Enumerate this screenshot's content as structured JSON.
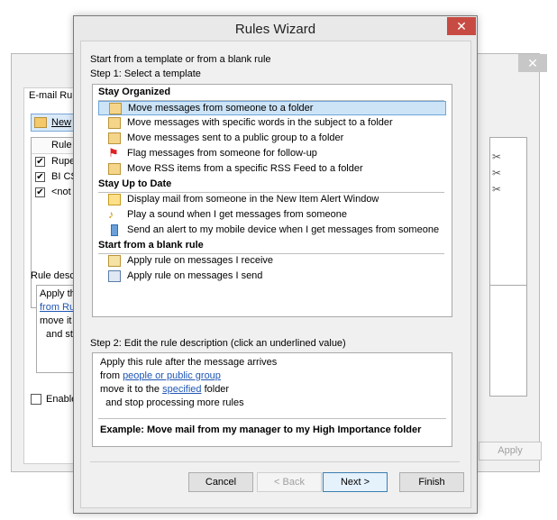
{
  "background_window": {
    "tab_label": "E-mail Rule",
    "new_button_label": "New",
    "list_header": "Rule",
    "rules": [
      {
        "checked": true,
        "name": "Rupe"
      },
      {
        "checked": true,
        "name": "BI CS"
      },
      {
        "checked": true,
        "name": "<not"
      }
    ],
    "description_label": "Rule desc",
    "description_lines": [
      "Apply th",
      "from Rup",
      "move it t",
      "and sto"
    ],
    "enable_label": "Enable",
    "apply_label": "Apply"
  },
  "dialog": {
    "title": "Rules Wizard",
    "close_glyph": "✕",
    "intro": "Start from a template or from a blank rule",
    "step1_label": "Step 1: Select a template",
    "groups": [
      {
        "heading": "Stay Organized",
        "items": [
          {
            "icon": "folder-move-icon",
            "label": "Move messages from someone to a folder",
            "selected": true
          },
          {
            "icon": "folder-move-icon",
            "label": "Move messages with specific words in the subject to a folder",
            "selected": false
          },
          {
            "icon": "folder-move-icon",
            "label": "Move messages sent to a public group to a folder",
            "selected": false
          },
          {
            "icon": "flag-icon",
            "label": "Flag messages from someone for follow-up",
            "selected": false
          },
          {
            "icon": "rss-folder-icon",
            "label": "Move RSS items from a specific RSS Feed to a folder",
            "selected": false
          }
        ]
      },
      {
        "heading": "Stay Up to Date",
        "items": [
          {
            "icon": "alert-window-icon",
            "label": "Display mail from someone in the New Item Alert Window",
            "selected": false
          },
          {
            "icon": "sound-icon",
            "label": "Play a sound when I get messages from someone",
            "selected": false
          },
          {
            "icon": "mobile-device-icon",
            "label": "Send an alert to my mobile device when I get messages from someone",
            "selected": false
          }
        ]
      },
      {
        "heading": "Start from a blank rule",
        "items": [
          {
            "icon": "envelope-receive-icon",
            "label": "Apply rule on messages I receive",
            "selected": false
          },
          {
            "icon": "envelope-send-icon",
            "label": "Apply rule on messages I send",
            "selected": false
          }
        ]
      }
    ],
    "step2_label": "Step 2: Edit the rule description (click an underlined value)",
    "description": {
      "line1": "Apply this rule after the message arrives",
      "line2_prefix": "from ",
      "line2_link": "people or public group",
      "line3_prefix": "move it to the ",
      "line3_link": "specified",
      "line3_suffix": " folder",
      "line4": "  and stop processing more rules",
      "example": "Example: Move mail from my manager to my High Importance folder"
    },
    "buttons": {
      "cancel": "Cancel",
      "back": "< Back",
      "next": "Next >",
      "finish": "Finish"
    }
  }
}
